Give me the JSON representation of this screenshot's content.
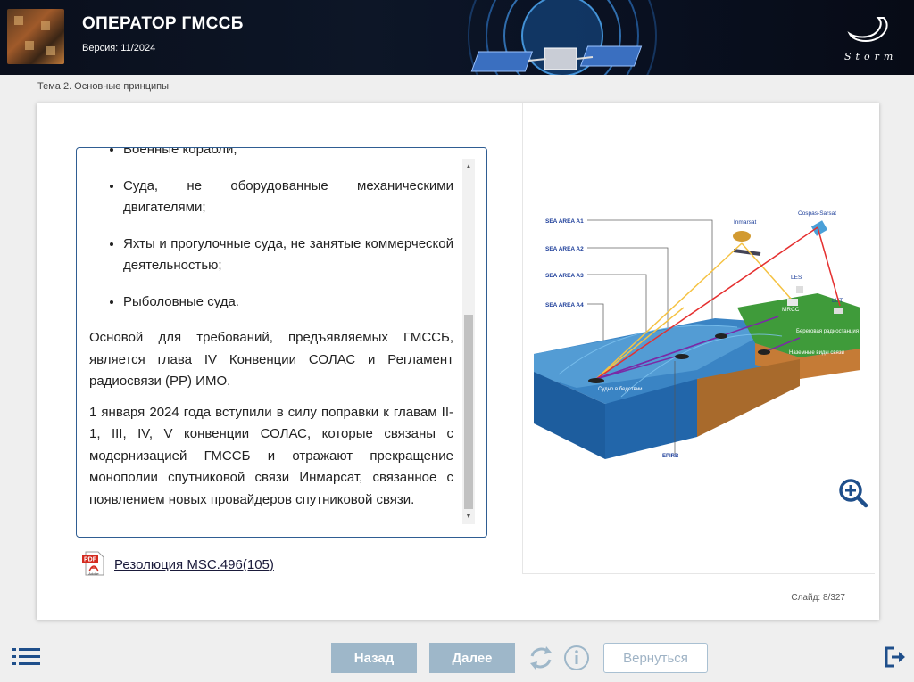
{
  "header": {
    "title": "ОПЕРАТОР ГМССБ",
    "version": "Версия: 11/2024",
    "brand": "Storm"
  },
  "breadcrumb": "Тема 2. Основные принципы",
  "content": {
    "list_items": [
      "Военные корабли;",
      "Суда, не оборудованные механическими двигателями;",
      "Яхты и прогулочные суда, не занятые коммерческой деятельностью;",
      "Рыболовные суда."
    ],
    "paragraphs": [
      "Основой для требований, предъявляемых ГМССБ, является глава IV Конвенции СОЛАС и Регламент радиосвязи (РР) ИМО.",
      "1 января 2024 года вступили в силу поправки к главам II-1, III, IV, V конвенции СОЛАС, которые связаны с модернизацией ГМССБ и отражают прекращение монополии спутниковой связи Инмарсат, связанное с появлением новых провайдеров спутниковой связи."
    ]
  },
  "attachment": {
    "label": "Резолюция MSC.496(105)",
    "icon_text": "PDF",
    "icon_brand": "Adobe"
  },
  "diagram": {
    "sea_areas": [
      "SEA AREA A1",
      "SEA AREA A2",
      "SEA AREA A3",
      "SEA AREA A4"
    ],
    "labels": {
      "inmarsat": "Inmarsat",
      "cospas": "Cospas-Sarsat",
      "les": "LES",
      "lut": "LUT",
      "mrcc": "MRCC",
      "coast_station": "Береговая радиостанция",
      "land_comms": "Наземные виды связи",
      "vessel": "Судно в бедствии",
      "epirb": "EPIRB"
    }
  },
  "slide": {
    "label": "Слайд:",
    "current": "8",
    "total": "327"
  },
  "nav": {
    "back": "Назад",
    "next": "Далее",
    "return": "Вернуться"
  },
  "colors": {
    "header_bg": "#0b1224",
    "box_border": "#2f5d92",
    "nav_button": "#9eb7c9",
    "icon": "#1f4f8b"
  }
}
